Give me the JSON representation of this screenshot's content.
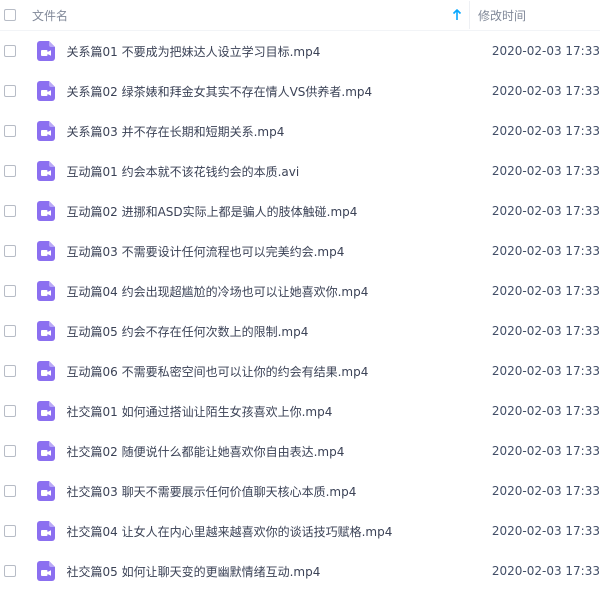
{
  "header": {
    "name_label": "文件名",
    "mtime_label": "修改时间",
    "sort_icon": "arrow-up-icon"
  },
  "colors": {
    "accent": "#06a7ff",
    "video_icon": "#8b6ff0"
  },
  "files": [
    {
      "name": "关系篇01 不要成为把妹达人设立学习目标.mp4",
      "mtime": "2020-02-03 17:33"
    },
    {
      "name": "关系篇02 绿茶婊和拜金女其实不存在情人VS供养者.mp4",
      "mtime": "2020-02-03 17:33"
    },
    {
      "name": "关系篇03 并不存在长期和短期关系.mp4",
      "mtime": "2020-02-03 17:33"
    },
    {
      "name": "互动篇01 约会本就不该花钱约会的本质.avi",
      "mtime": "2020-02-03 17:33"
    },
    {
      "name": "互动篇02 进挪和ASD实际上都是骗人的肢体触碰.mp4",
      "mtime": "2020-02-03 17:33"
    },
    {
      "name": "互动篇03 不需要设计任何流程也可以完美约会.mp4",
      "mtime": "2020-02-03 17:33"
    },
    {
      "name": "互动篇04 约会出现超尴尬的冷场也可以让她喜欢你.mp4",
      "mtime": "2020-02-03 17:33"
    },
    {
      "name": "互动篇05 约会不存在任何次数上的限制.mp4",
      "mtime": "2020-02-03 17:33"
    },
    {
      "name": "互动篇06 不需要私密空间也可以让你的约会有结果.mp4",
      "mtime": "2020-02-03 17:33"
    },
    {
      "name": "社交篇01 如何通过搭讪让陌生女孩喜欢上你.mp4",
      "mtime": "2020-02-03 17:33"
    },
    {
      "name": "社交篇02 随便说什么都能让她喜欢你自由表达.mp4",
      "mtime": "2020-02-03 17:33"
    },
    {
      "name": "社交篇03 聊天不需要展示任何价值聊天核心本质.mp4",
      "mtime": "2020-02-03 17:33"
    },
    {
      "name": "社交篇04 让女人在内心里越来越喜欢你的谈话技巧赋格.mp4",
      "mtime": "2020-02-03 17:33"
    },
    {
      "name": "社交篇05 如何让聊天变的更幽默情绪互动.mp4",
      "mtime": "2020-02-03 17:33"
    }
  ]
}
